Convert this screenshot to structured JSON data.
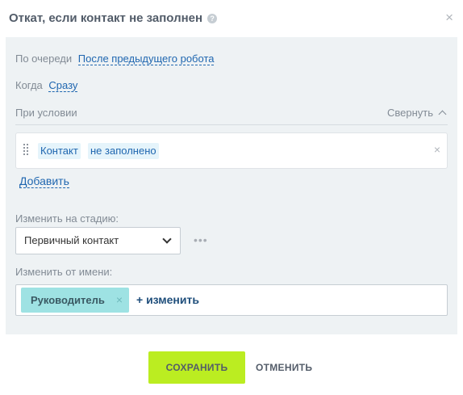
{
  "header": {
    "title": "Откат, если контакт не заполнен",
    "help_icon": "question-circle-icon",
    "close_icon": "close-icon",
    "close_glyph": "×"
  },
  "queue": {
    "label": "По очереди",
    "value": "После предыдущего робота"
  },
  "when": {
    "label": "Когда",
    "value": "Сразу"
  },
  "condition": {
    "label": "При условии",
    "collapse_label": "Свернуть",
    "field": "Контакт",
    "operator": "не заполнено",
    "remove_glyph": "×",
    "add_label": "Добавить"
  },
  "stage": {
    "label": "Изменить на стадию:",
    "selected": "Первичный контакт",
    "more_glyph": "•••"
  },
  "modified_by": {
    "label": "Изменить от имени:",
    "user": "Руководитель",
    "remove_glyph": "×",
    "change_label": "+ изменить"
  },
  "footer": {
    "save_label": "СОХРАНИТЬ",
    "cancel_label": "ОТМЕНИТЬ"
  },
  "colors": {
    "save_bg": "#bbed21",
    "link": "#2067b0",
    "panel_bg": "#eef2f4",
    "user_chip_bg": "#9ee2e3"
  }
}
